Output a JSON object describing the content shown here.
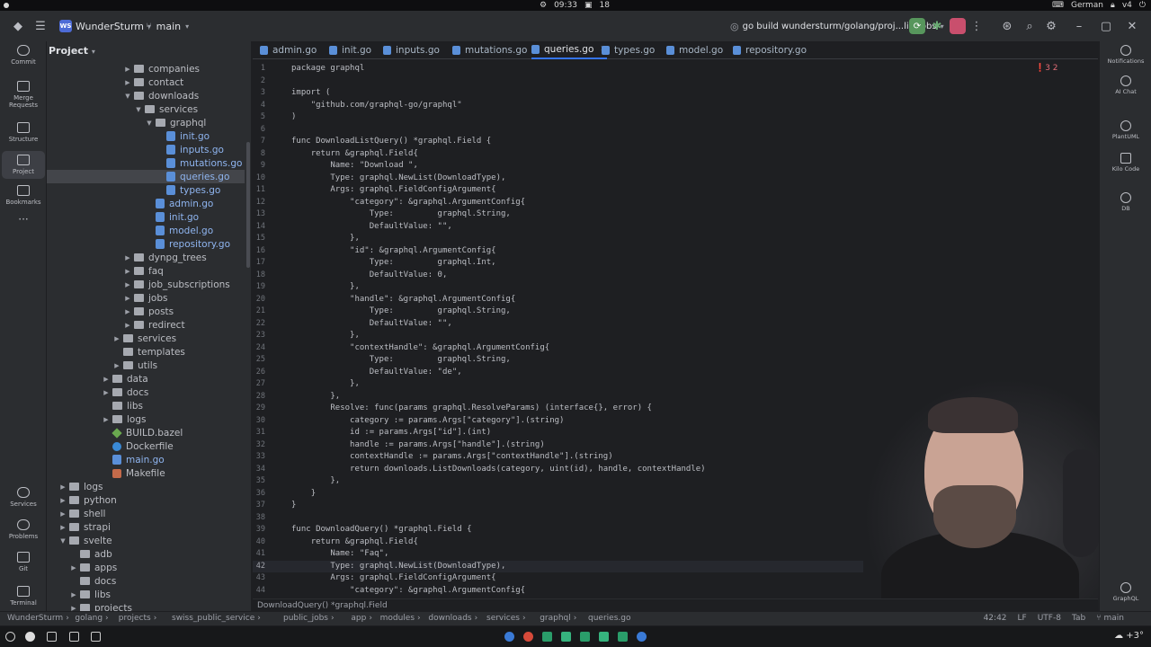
{
  "os_bar": {
    "time": "09:33",
    "workspace": "18",
    "language": "German",
    "vpn": "v4"
  },
  "header": {
    "project_badge": "WS",
    "project_name": "WunderSturm",
    "branch": "main",
    "run_config": "go build wundersturm/golang/proj...lic_jobs"
  },
  "left_tools": [
    {
      "label": "Commit"
    },
    {
      "label": "Merge Requests"
    },
    {
      "label": "Structure"
    },
    {
      "label": "Project"
    },
    {
      "label": "Bookmarks"
    },
    {
      "label": "Services"
    },
    {
      "label": "Problems"
    },
    {
      "label": "Git"
    },
    {
      "label": "Terminal"
    }
  ],
  "project_panel": {
    "title": "Project",
    "tree": [
      {
        "label": "companies",
        "type": "folder",
        "expanded": false
      },
      {
        "label": "contact",
        "type": "folder",
        "expanded": false
      },
      {
        "label": "downloads",
        "type": "folder",
        "expanded": true
      },
      {
        "label": "services",
        "type": "folder",
        "expanded": true
      },
      {
        "label": "graphql",
        "type": "folder",
        "expanded": true
      },
      {
        "label": "init.go",
        "type": "go"
      },
      {
        "label": "inputs.go",
        "type": "go"
      },
      {
        "label": "mutations.go",
        "type": "go"
      },
      {
        "label": "queries.go",
        "type": "go",
        "selected": true
      },
      {
        "label": "types.go",
        "type": "go"
      },
      {
        "label": "admin.go",
        "type": "go"
      },
      {
        "label": "init.go",
        "type": "go"
      },
      {
        "label": "model.go",
        "type": "go"
      },
      {
        "label": "repository.go",
        "type": "go"
      },
      {
        "label": "dynpg_trees",
        "type": "folder",
        "expanded": false
      },
      {
        "label": "faq",
        "type": "folder",
        "expanded": false
      },
      {
        "label": "job_subscriptions",
        "type": "folder",
        "expanded": false
      },
      {
        "label": "jobs",
        "type": "folder",
        "expanded": false
      },
      {
        "label": "posts",
        "type": "folder",
        "expanded": false
      },
      {
        "label": "redirect",
        "type": "folder",
        "expanded": false
      },
      {
        "label": "services",
        "type": "folder",
        "expanded": false
      },
      {
        "label": "templates",
        "type": "folder"
      },
      {
        "label": "utils",
        "type": "folder",
        "expanded": false
      },
      {
        "label": "data",
        "type": "folder",
        "expanded": false
      },
      {
        "label": "docs",
        "type": "folder",
        "expanded": false
      },
      {
        "label": "libs",
        "type": "folder"
      },
      {
        "label": "logs",
        "type": "folder",
        "expanded": false
      },
      {
        "label": "BUILD.bazel",
        "type": "bazel"
      },
      {
        "label": "Dockerfile",
        "type": "docker"
      },
      {
        "label": "main.go",
        "type": "go"
      },
      {
        "label": "Makefile",
        "type": "make"
      },
      {
        "label": "logs",
        "type": "folder",
        "expanded": false
      },
      {
        "label": "python",
        "type": "folder",
        "expanded": false
      },
      {
        "label": "shell",
        "type": "folder",
        "expanded": false
      },
      {
        "label": "strapi",
        "type": "folder",
        "expanded": false
      },
      {
        "label": "svelte",
        "type": "folder",
        "expanded": true
      },
      {
        "label": "adb",
        "type": "folder"
      },
      {
        "label": "apps",
        "type": "folder",
        "expanded": false
      },
      {
        "label": "docs",
        "type": "folder"
      },
      {
        "label": "libs",
        "type": "folder",
        "expanded": false
      },
      {
        "label": "projects",
        "type": "folder",
        "expanded": false
      }
    ]
  },
  "tabs": [
    {
      "label": "admin.go"
    },
    {
      "label": "init.go"
    },
    {
      "label": "inputs.go"
    },
    {
      "label": "mutations.go"
    },
    {
      "label": "queries.go",
      "active": true
    },
    {
      "label": "types.go"
    },
    {
      "label": "model.go"
    },
    {
      "label": "repository.go"
    }
  ],
  "editor": {
    "inspection": "3  2",
    "current_line": 42,
    "lines": [
      "package graphql",
      "",
      "import (",
      "\t\"github.com/graphql-go/graphql\"",
      ")",
      "",
      "func DownloadListQuery() *graphql.Field {",
      "\treturn &graphql.Field{",
      "\t\tName: \"Download \",",
      "\t\tType: graphql.NewList(DownloadType),",
      "\t\tArgs: graphql.FieldConfigArgument{",
      "\t\t\t\"category\": &graphql.ArgumentConfig{",
      "\t\t\t\tType:         graphql.String,",
      "\t\t\t\tDefaultValue: \"\",",
      "\t\t\t},",
      "\t\t\t\"id\": &graphql.ArgumentConfig{",
      "\t\t\t\tType:         graphql.Int,",
      "\t\t\t\tDefaultValue: 0,",
      "\t\t\t},",
      "\t\t\t\"handle\": &graphql.ArgumentConfig{",
      "\t\t\t\tType:         graphql.String,",
      "\t\t\t\tDefaultValue: \"\",",
      "\t\t\t},",
      "\t\t\t\"contextHandle\": &graphql.ArgumentConfig{",
      "\t\t\t\tType:         graphql.String,",
      "\t\t\t\tDefaultValue: \"de\",",
      "\t\t\t},",
      "\t\t},",
      "\t\tResolve: func(params graphql.ResolveParams) (interface{}, error) {",
      "\t\t\tcategory := params.Args[\"category\"].(string)",
      "\t\t\tid := params.Args[\"id\"].(int)",
      "\t\t\thandle := params.Args[\"handle\"].(string)",
      "\t\t\tcontextHandle := params.Args[\"contextHandle\"].(string)",
      "\t\t\treturn downloads.ListDownloads(category, uint(id), handle, contextHandle)",
      "\t\t},",
      "\t}",
      "}",
      "",
      "func DownloadQuery() *graphql.Field {",
      "\treturn &graphql.Field{",
      "\t\tName: \"Faq\",",
      "\t\tType: graphql.NewList(DownloadType),",
      "\t\tArgs: graphql.FieldConfigArgument{",
      "\t\t\t\"category\": &graphql.ArgumentConfig{"
    ],
    "context_crumb": "DownloadQuery() *graphql.Field"
  },
  "right_tools": [
    {
      "label": "Notifications"
    },
    {
      "label": "AI Chat"
    },
    {
      "label": "PlantUML"
    },
    {
      "label": "Kilo Code"
    },
    {
      "label": "DB"
    },
    {
      "label": "GraphQL"
    }
  ],
  "statusbar": {
    "breadcrumb": [
      "WunderSturm",
      "golang",
      "projects",
      "swiss_public_service",
      "public_jobs",
      "app",
      "modules",
      "downloads",
      "services",
      "graphql",
      "queries.go"
    ],
    "position": "42:42",
    "line_sep": "LF",
    "encoding": "UTF-8",
    "indent": "Tab",
    "branch": "main"
  }
}
